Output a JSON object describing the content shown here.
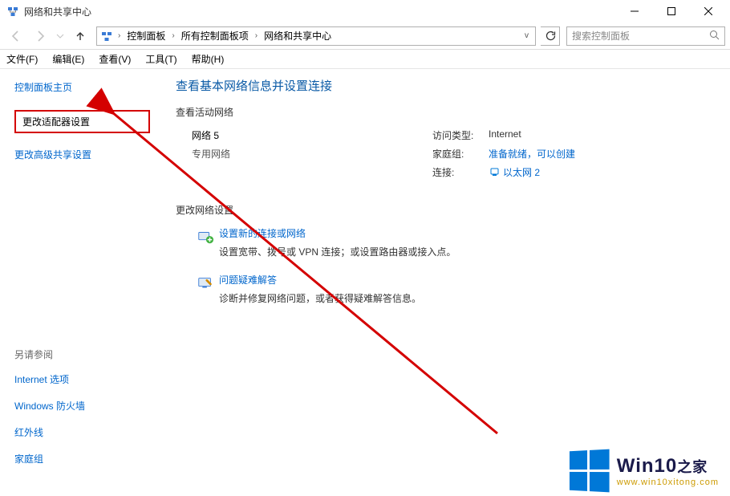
{
  "window_title": "网络和共享中心",
  "nav": {
    "crumbs": [
      "控制面板",
      "所有控制面板项",
      "网络和共享中心"
    ]
  },
  "search": {
    "placeholder": "搜索控制面板"
  },
  "menubar": [
    "文件(F)",
    "编辑(E)",
    "查看(V)",
    "工具(T)",
    "帮助(H)"
  ],
  "left": {
    "home": "控制面板主页",
    "link_adapter": "更改适配器设置",
    "link_advshare": "更改高级共享设置",
    "seealso_title": "另请参阅",
    "seealso": [
      "Internet 选项",
      "Windows 防火墙",
      "红外线",
      "家庭组"
    ]
  },
  "main": {
    "heading": "查看基本网络信息并设置连接",
    "active_net_label": "查看活动网络",
    "network_name": "网络  5",
    "network_type": "专用网络",
    "kv_access_k": "访问类型:",
    "kv_access_v": "Internet",
    "kv_homegroup_k": "家庭组:",
    "kv_homegroup_v": "准备就绪，可以创建",
    "kv_conn_k": "连接:",
    "kv_conn_v": "以太网 2",
    "change_settings_label": "更改网络设置",
    "setup_title": "设置新的连接或网络",
    "setup_desc": "设置宽带、拨号或 VPN 连接；或设置路由器或接入点。",
    "trouble_title": "问题疑难解答",
    "trouble_desc": "诊断并修复网络问题，或者获得疑难解答信息。"
  },
  "watermark": {
    "brand_en": "Win10",
    "brand_zh": "之家",
    "url": "www.win10xitong.com"
  }
}
